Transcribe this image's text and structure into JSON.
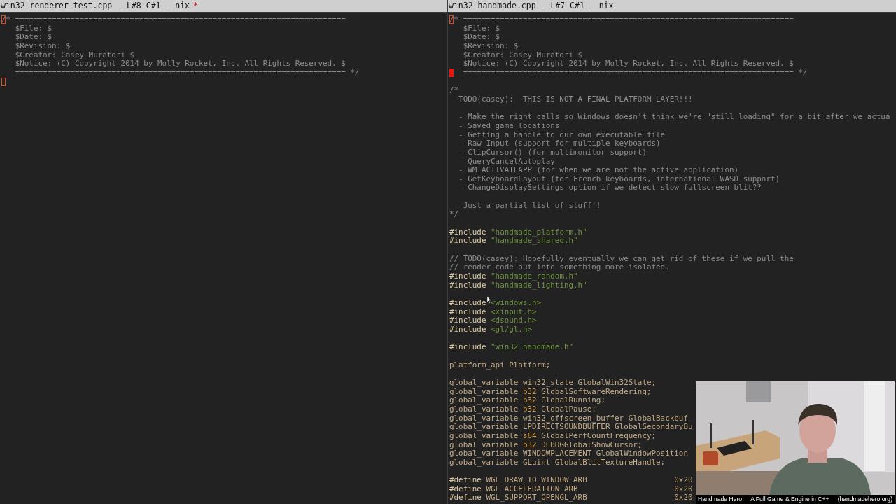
{
  "panes": [
    {
      "title": "win32_renderer_test.cpp - L#8 C#1 - nix",
      "modified_marker": "*",
      "lines": [
        {
          "kind": "code",
          "cursor": true,
          "filled": false,
          "tokens": [
            {
              "kind": "comment",
              "text": "/* ========================================================================"
            }
          ]
        },
        {
          "kind": "code",
          "tokens": [
            {
              "kind": "comment",
              "text": "   $File: $"
            }
          ]
        },
        {
          "kind": "code",
          "tokens": [
            {
              "kind": "comment",
              "text": "   $Date: $"
            }
          ]
        },
        {
          "kind": "code",
          "tokens": [
            {
              "kind": "comment",
              "text": "   $Revision: $"
            }
          ]
        },
        {
          "kind": "code",
          "tokens": [
            {
              "kind": "comment",
              "text": "   $Creator: Casey Muratori $"
            }
          ]
        },
        {
          "kind": "code",
          "tokens": [
            {
              "kind": "comment",
              "text": "   $Notice: (C) Copyright 2014 by Molly Rocket, Inc. All Rights Reserved. $"
            }
          ]
        },
        {
          "kind": "code",
          "tokens": [
            {
              "kind": "comment",
              "text": "   ======================================================================== */"
            }
          ]
        },
        {
          "kind": "blank",
          "cursor": true,
          "filled": false
        }
      ]
    },
    {
      "title": "win32_handmade.cpp - L#7 C#1 - nix",
      "lines": [
        {
          "kind": "code",
          "cursor": true,
          "filled": false,
          "tokens": [
            {
              "kind": "comment",
              "text": "/* ========================================================================"
            }
          ]
        },
        {
          "kind": "code",
          "tokens": [
            {
              "kind": "comment",
              "text": "   $File: $"
            }
          ]
        },
        {
          "kind": "code",
          "tokens": [
            {
              "kind": "comment",
              "text": "   $Date: $"
            }
          ]
        },
        {
          "kind": "code",
          "tokens": [
            {
              "kind": "comment",
              "text": "   $Revision: $"
            }
          ]
        },
        {
          "kind": "code",
          "tokens": [
            {
              "kind": "comment",
              "text": "   $Creator: Casey Muratori $"
            }
          ]
        },
        {
          "kind": "code",
          "tokens": [
            {
              "kind": "comment",
              "text": "   $Notice: (C) Copyright 2014 by Molly Rocket, Inc. All Rights Reserved. $"
            }
          ]
        },
        {
          "kind": "code",
          "cursor": true,
          "filled": true,
          "tokens": [
            {
              "kind": "comment",
              "text": "   ======================================================================== */"
            }
          ]
        },
        {
          "kind": "blank"
        },
        {
          "kind": "code",
          "tokens": [
            {
              "kind": "comment",
              "text": "/*"
            }
          ]
        },
        {
          "kind": "code",
          "tokens": [
            {
              "kind": "comment",
              "text": "  TODO(casey):  THIS IS NOT A FINAL PLATFORM LAYER!!!"
            }
          ]
        },
        {
          "kind": "blank"
        },
        {
          "kind": "code",
          "tokens": [
            {
              "kind": "comment",
              "text": "  - Make the right calls so Windows doesn't think we're \"still loading\" for a bit after we actua"
            }
          ]
        },
        {
          "kind": "code",
          "tokens": [
            {
              "kind": "comment",
              "text": "  - Saved game locations"
            }
          ]
        },
        {
          "kind": "code",
          "tokens": [
            {
              "kind": "comment",
              "text": "  - Getting a handle to our own executable file"
            }
          ]
        },
        {
          "kind": "code",
          "tokens": [
            {
              "kind": "comment",
              "text": "  - Raw Input (support for multiple keyboards)"
            }
          ]
        },
        {
          "kind": "code",
          "tokens": [
            {
              "kind": "comment",
              "text": "  - ClipCursor() (for multimonitor support)"
            }
          ]
        },
        {
          "kind": "code",
          "tokens": [
            {
              "kind": "comment",
              "text": "  - QueryCancelAutoplay"
            }
          ]
        },
        {
          "kind": "code",
          "tokens": [
            {
              "kind": "comment",
              "text": "  - WM_ACTIVATEAPP (for when we are not the active application)"
            }
          ]
        },
        {
          "kind": "code",
          "tokens": [
            {
              "kind": "comment",
              "text": "  - GetKeyboardLayout (for French keyboards, international WASD support)"
            }
          ]
        },
        {
          "kind": "code",
          "tokens": [
            {
              "kind": "comment",
              "text": "  - ChangeDisplaySettings option if we detect slow fullscreen blit??"
            }
          ]
        },
        {
          "kind": "blank"
        },
        {
          "kind": "code",
          "tokens": [
            {
              "kind": "comment",
              "text": "   Just a partial list of stuff!!"
            }
          ]
        },
        {
          "kind": "code",
          "tokens": [
            {
              "kind": "comment",
              "text": "*/"
            }
          ]
        },
        {
          "kind": "blank"
        },
        {
          "kind": "code",
          "tokens": [
            {
              "kind": "preproc",
              "text": "#include"
            },
            {
              "kind": "string",
              "text": "\"handmade_platform.h\""
            }
          ]
        },
        {
          "kind": "code",
          "tokens": [
            {
              "kind": "preproc",
              "text": "#include"
            },
            {
              "kind": "string",
              "text": "\"handmade_shared.h\""
            }
          ]
        },
        {
          "kind": "blank"
        },
        {
          "kind": "code",
          "tokens": [
            {
              "kind": "comment",
              "text": "// TODO(casey): Hopefully eventually we can get rid of these if we pull the"
            }
          ]
        },
        {
          "kind": "code",
          "tokens": [
            {
              "kind": "comment",
              "text": "// render code out into something more isolated."
            }
          ]
        },
        {
          "kind": "code",
          "tokens": [
            {
              "kind": "preproc",
              "text": "#include"
            },
            {
              "kind": "string",
              "text": "\"handmade_random.h\""
            }
          ]
        },
        {
          "kind": "code",
          "tokens": [
            {
              "kind": "preproc",
              "text": "#include"
            },
            {
              "kind": "string",
              "text": "\"handmade_lighting.h\""
            }
          ]
        },
        {
          "kind": "blank"
        },
        {
          "kind": "code",
          "tokens": [
            {
              "kind": "preproc",
              "text": "#include"
            },
            {
              "kind": "string",
              "text": "<windows.h>"
            }
          ]
        },
        {
          "kind": "code",
          "tokens": [
            {
              "kind": "preproc",
              "text": "#include"
            },
            {
              "kind": "string",
              "text": "<xinput.h>"
            }
          ]
        },
        {
          "kind": "code",
          "tokens": [
            {
              "kind": "preproc",
              "text": "#include"
            },
            {
              "kind": "string",
              "text": "<dsound.h>"
            }
          ]
        },
        {
          "kind": "code",
          "tokens": [
            {
              "kind": "preproc",
              "text": "#include"
            },
            {
              "kind": "string",
              "text": "<gl/gl.h>"
            }
          ]
        },
        {
          "kind": "blank"
        },
        {
          "kind": "code",
          "tokens": [
            {
              "kind": "preproc",
              "text": "#include"
            },
            {
              "kind": "string",
              "text": "\"win32_handmade.h\""
            }
          ]
        },
        {
          "kind": "blank"
        },
        {
          "kind": "code",
          "tokens": [
            {
              "kind": "code",
              "text": "platform_api Platform;"
            }
          ]
        },
        {
          "kind": "blank"
        },
        {
          "kind": "code",
          "tokens": [
            {
              "kind": "code",
              "text": "global_variable win32_state GlobalWin32State;"
            }
          ]
        },
        {
          "kind": "code",
          "tokens": [
            {
              "kind": "code",
              "text": "global_variable"
            },
            {
              "kind": "type",
              "text": "b32"
            },
            {
              "kind": "code",
              "text": "GlobalSoftwareRendering;"
            }
          ]
        },
        {
          "kind": "code",
          "tokens": [
            {
              "kind": "code",
              "text": "global_variable"
            },
            {
              "kind": "type",
              "text": "b32"
            },
            {
              "kind": "code",
              "text": "GlobalRunning;"
            }
          ]
        },
        {
          "kind": "code",
          "tokens": [
            {
              "kind": "code",
              "text": "global_variable"
            },
            {
              "kind": "type",
              "text": "b32"
            },
            {
              "kind": "code",
              "text": "GlobalPause;"
            }
          ]
        },
        {
          "kind": "code",
          "tokens": [
            {
              "kind": "code",
              "text": "global_variable win32_offscreen_buffer GlobalBackbuf"
            }
          ]
        },
        {
          "kind": "code",
          "tokens": [
            {
              "kind": "code",
              "text": "global_variable LPDIRECTSOUNDBUFFER GlobalSecondaryBu"
            }
          ]
        },
        {
          "kind": "code",
          "tokens": [
            {
              "kind": "code",
              "text": "global_variable"
            },
            {
              "kind": "type",
              "text": "s64"
            },
            {
              "kind": "code",
              "text": "GlobalPerfCountFrequency;"
            }
          ]
        },
        {
          "kind": "code",
          "tokens": [
            {
              "kind": "code",
              "text": "global_variable"
            },
            {
              "kind": "type",
              "text": "b32"
            },
            {
              "kind": "code",
              "text": "DEBUGGlobalShowCursor;"
            }
          ]
        },
        {
          "kind": "code",
          "tokens": [
            {
              "kind": "code",
              "text": "global_variable WINDOWPLACEMENT GlobalWindowPosition"
            }
          ]
        },
        {
          "kind": "code",
          "tokens": [
            {
              "kind": "code",
              "text": "global_variable GLuint GlobalBlitTextureHandle;"
            }
          ]
        },
        {
          "kind": "blank"
        },
        {
          "kind": "code",
          "tokens": [
            {
              "kind": "preproc",
              "text": "#define"
            },
            {
              "kind": "code",
              "text": "WGL_DRAW_TO_WINDOW_ARB                   0x20"
            }
          ]
        },
        {
          "kind": "code",
          "tokens": [
            {
              "kind": "preproc",
              "text": "#define"
            },
            {
              "kind": "code",
              "text": "WGL_ACCELERATION_ARB                     0x20"
            }
          ]
        },
        {
          "kind": "code",
          "tokens": [
            {
              "kind": "preproc",
              "text": "#define"
            },
            {
              "kind": "code",
              "text": "WGL_SUPPORT_OPENGL_ARB                   0x20"
            }
          ]
        }
      ]
    }
  ],
  "webcam": {
    "kind": "picture",
    "caption": [
      "Handmade Hero",
      "A Full Game & Engine in C++",
      "(handmadehero.org)"
    ]
  }
}
